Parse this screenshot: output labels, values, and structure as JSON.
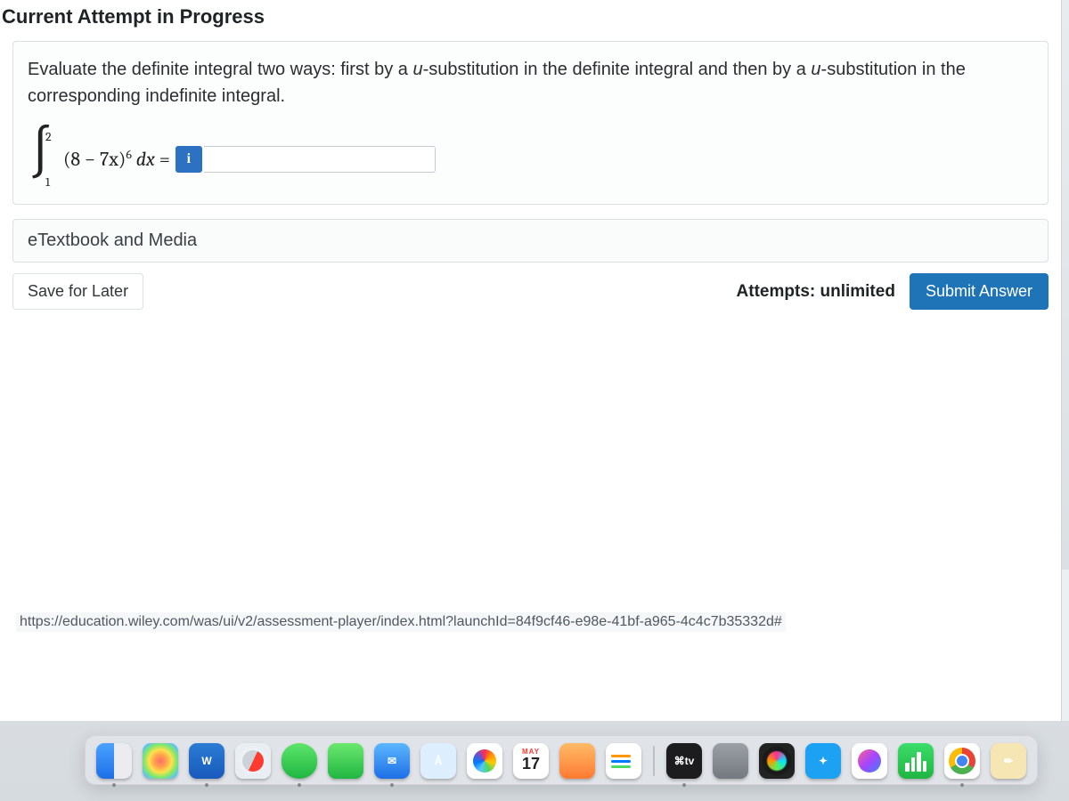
{
  "header": {
    "title": "Current Attempt in Progress"
  },
  "question": {
    "prompt_before": "Evaluate the definite integral two ways: first by a ",
    "prompt_u1": "u",
    "prompt_mid1": "-substitution in the definite integral and then by a ",
    "prompt_u2": "u",
    "prompt_mid2": "-substitution in the corresponding indefinite integral.",
    "integral": {
      "lower": "1",
      "upper": "2",
      "integrand_open": "(8 − 7x)",
      "exponent": "6",
      "dx": " dx",
      "equals": " = "
    },
    "info_button_label": "i",
    "answer_value": ""
  },
  "links": {
    "etextbook": "eTextbook and Media"
  },
  "actions": {
    "save_label": "Save for Later",
    "attempts_text": "Attempts: unlimited",
    "submit_label": "Submit Answer"
  },
  "hover_url": "https://education.wiley.com/was/ui/v2/assessment-player/index.html?launchId=84f9cf46-e98e-41bf-a965-4c4c7b35332d#",
  "dock": {
    "calendar": {
      "month": "MAY",
      "day": "17"
    },
    "tv_label": "⌘tv"
  }
}
